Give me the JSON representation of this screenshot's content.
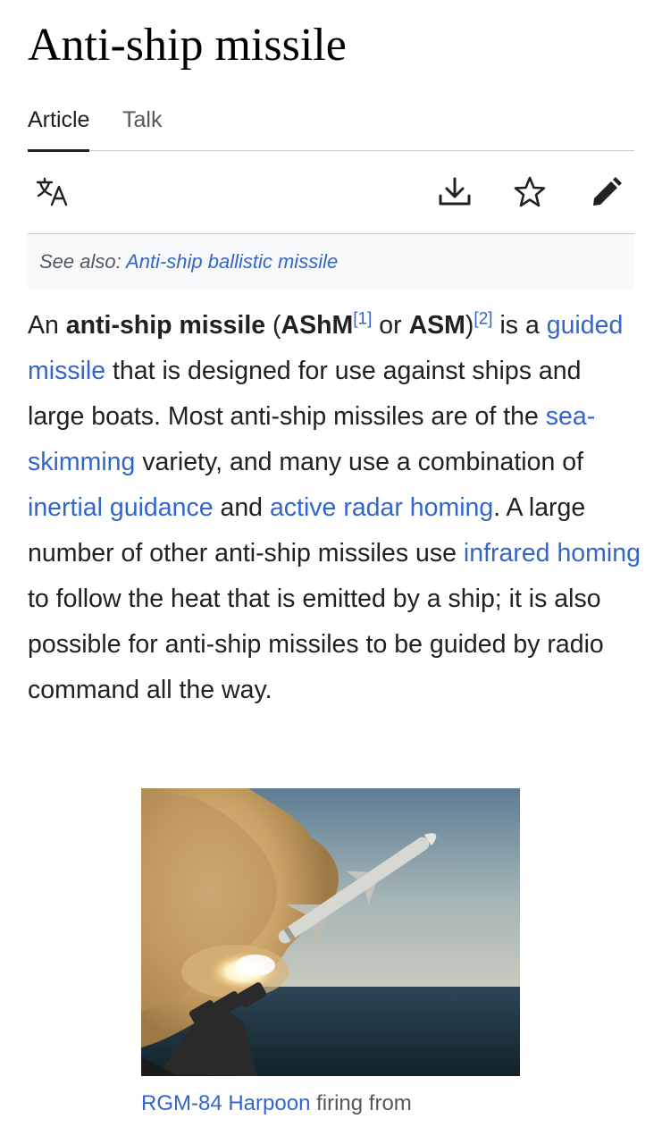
{
  "page": {
    "title": "Anti-ship missile"
  },
  "tabs": [
    {
      "label": "Article"
    },
    {
      "label": "Talk"
    }
  ],
  "toolbar": {
    "icons": [
      "language-icon",
      "download-icon",
      "star-icon",
      "edit-icon"
    ]
  },
  "hatnote": {
    "prefix": "See also: ",
    "link": "Anti-ship ballistic missile"
  },
  "article": {
    "p1": {
      "t1": "An ",
      "b1": "anti-ship missile",
      "t2": " (",
      "b2": "AShM",
      "ref1": "[1]",
      "t3": " or ",
      "b3": "ASM",
      "t4": ")",
      "ref2": "[2]",
      "t5": " is a ",
      "l1": "guided missile",
      "t6": " that is designed for use against ships and large boats. Most anti-ship missiles are of the ",
      "l2": "sea-skimming",
      "t7": " variety, and many use a combination of ",
      "l3": "inertial guidance",
      "t8": " and ",
      "l4": "active radar homing",
      "t9": ". A large number of other anti-ship missiles use ",
      "l5": "infrared homing",
      "t10": " to follow the heat that is emitted by a ship; it is also possible for anti-ship missiles to be guided by radio command all the way."
    }
  },
  "figure": {
    "caption_link": "RGM-84 Harpoon",
    "caption_text": " firing from"
  },
  "colors": {
    "link": "#3366cc",
    "text": "#202122",
    "muted": "#54595d",
    "hatnote_bg": "#f8f9fa"
  }
}
